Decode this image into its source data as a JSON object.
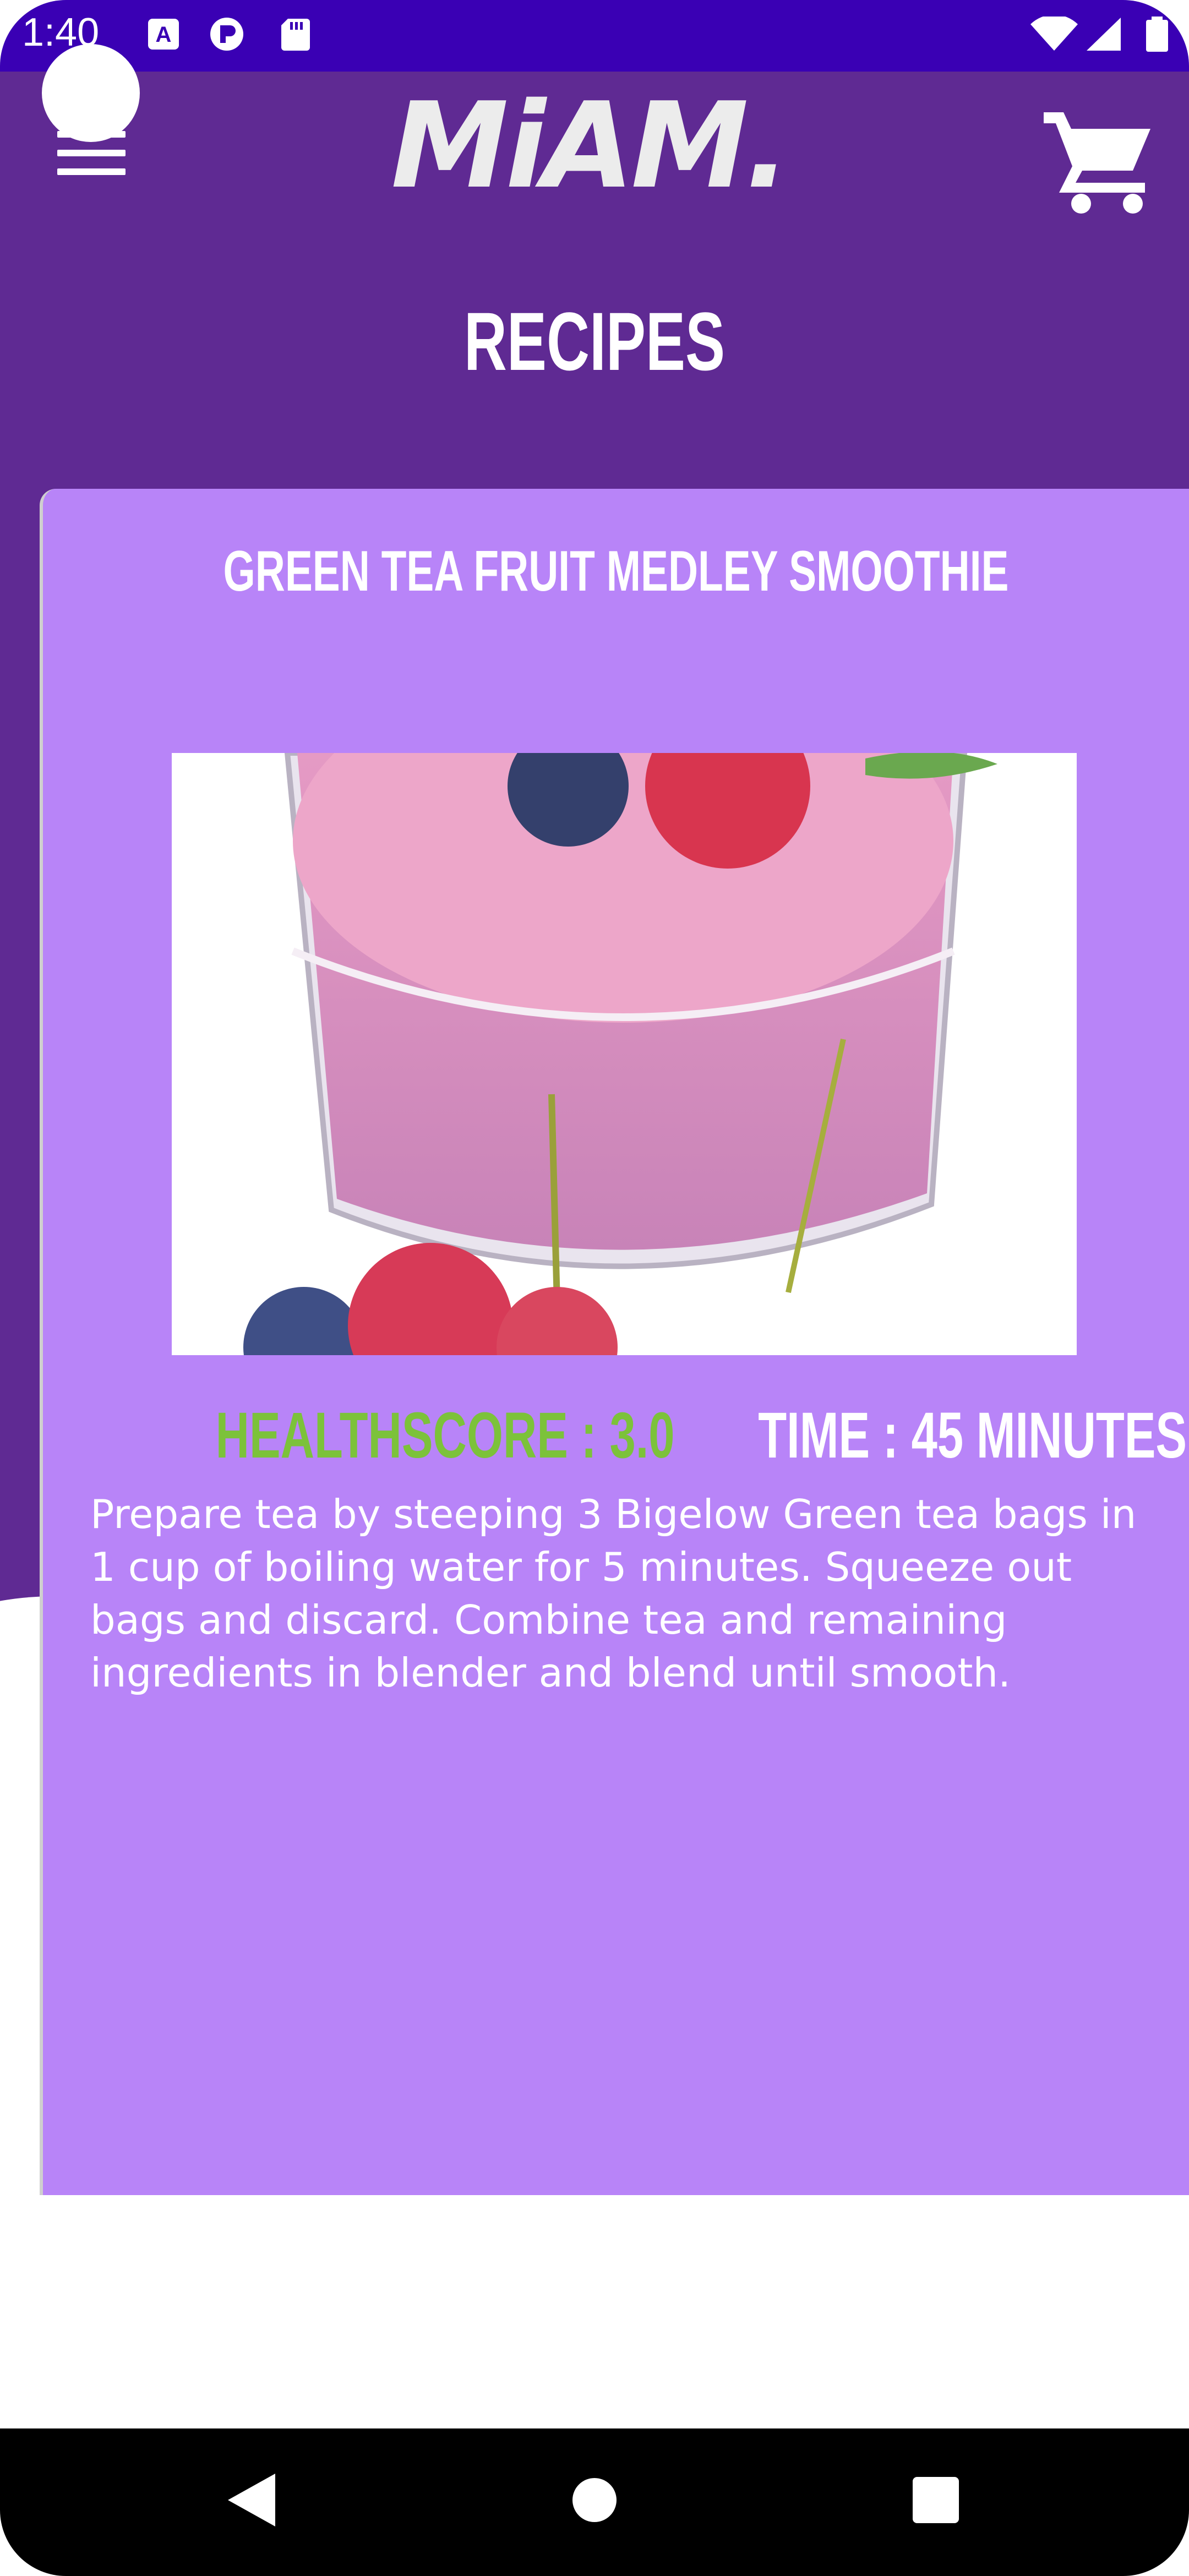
{
  "status_bar": {
    "time": "1:40",
    "icons": [
      "a-icon",
      "pi-icon",
      "sd-card-icon",
      "wifi-icon",
      "signal-icon",
      "battery-icon"
    ]
  },
  "header": {
    "logo": "MiAM.",
    "title": "RECIPES",
    "menu_icon": "hamburger-menu-icon",
    "cart_icon": "shopping-cart-icon"
  },
  "recipe": {
    "title": "GREEN TEA FRUIT MEDLEY SMOOTHIE",
    "image_alt": "smoothie-image",
    "health_score": "HEALTHSCORE : 3.0",
    "time": "TIME : 45 MINUTES",
    "instructions": "Prepare tea by steeping 3 Bigelow Green tea bags in 1 cup of boiling water for 5 minutes. Squeeze out bags and discard. Combine tea and remaining ingredients in blender and blend until smooth."
  },
  "nav": {
    "back": "back-icon",
    "home": "home-icon",
    "recents": "recents-icon"
  },
  "colors": {
    "status_bar": "#3a00b4",
    "header": "#5f2a93",
    "card": "#b884f8",
    "health_score": "#7cc23a"
  }
}
